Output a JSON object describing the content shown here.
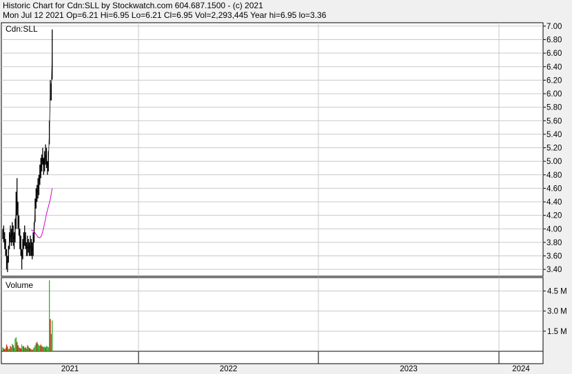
{
  "header": {
    "line1": "Historic Chart for Cdn:SLL by Stockwatch.com 604.687.1500 - (c) 2021",
    "line2": "Mon Jul 12 2021  Op=6.21  Hi=6.95  Lo=6.21  Cl=6.95  Vol=2,293,445  Year hi=6.95  lo=3.36"
  },
  "colors": {
    "background": "#ffffff",
    "grid": "#c8c8c8",
    "price_bar": "#000000",
    "moving_average": "#cc00cc",
    "volume_up": "#33aa33",
    "volume_down": "#cc2200"
  },
  "chart_data": [
    {
      "type": "line",
      "title": "Cdn:SLL",
      "ylim": [
        3.3,
        7.05
      ],
      "y_ticks": [
        "7.00",
        "6.80",
        "6.60",
        "6.40",
        "6.20",
        "6.00",
        "5.80",
        "5.60",
        "5.40",
        "5.20",
        "5.00",
        "4.80",
        "4.60",
        "4.40",
        "4.20",
        "4.00",
        "3.80",
        "3.60",
        "3.40"
      ],
      "x_labels": [
        "2021",
        "2022",
        "2023",
        "2024"
      ],
      "grid": true,
      "series": [
        {
          "style": "hl-bars",
          "high": [
            4.0,
            4.05,
            3.95,
            3.85,
            3.7,
            3.6,
            3.75,
            3.95,
            4.05,
            4.0,
            4.1,
            4.05,
            3.95,
            4.15,
            4.55,
            4.75,
            4.4,
            4.2,
            4.0,
            3.9,
            3.7,
            3.85,
            3.95,
            4.05,
            3.95,
            3.8,
            3.9,
            3.85,
            3.8,
            3.9,
            3.85,
            3.8,
            3.95,
            4.1,
            4.45,
            4.6,
            4.65,
            4.75,
            4.8,
            4.95,
            5.05,
            5.1,
            5.2,
            5.05,
            5.15,
            5.25,
            5.2,
            5.0,
            5.15,
            5.6,
            6.2,
            6.15,
            6.95
          ],
          "low": [
            3.85,
            3.8,
            3.7,
            3.6,
            3.4,
            3.36,
            3.5,
            3.7,
            3.8,
            3.75,
            3.8,
            3.75,
            3.7,
            3.8,
            4.0,
            4.2,
            4.0,
            3.9,
            3.7,
            3.6,
            3.4,
            3.55,
            3.7,
            3.75,
            3.7,
            3.6,
            3.6,
            3.65,
            3.6,
            3.6,
            3.6,
            3.55,
            3.6,
            3.8,
            4.1,
            4.3,
            4.4,
            4.45,
            4.5,
            4.65,
            4.75,
            4.85,
            4.95,
            4.8,
            4.85,
            4.95,
            4.9,
            4.8,
            4.85,
            5.25,
            5.9,
            5.9,
            6.21
          ]
        },
        {
          "style": "line",
          "start_index": 30,
          "values": [
            3.98,
            3.98,
            3.97,
            3.96,
            3.94,
            3.92,
            3.9,
            3.88,
            3.87,
            3.87,
            3.88,
            3.91,
            3.96,
            4.02,
            4.08,
            4.15,
            4.22,
            4.28,
            4.33,
            4.38,
            4.44,
            4.52,
            4.6
          ]
        }
      ]
    },
    {
      "type": "bar",
      "title": "Volume",
      "ylim": [
        0,
        5500000
      ],
      "y_ticks": [
        "4.5 M",
        "3.0 M",
        "1.5 M"
      ],
      "values": [
        300000,
        200000,
        150000,
        250000,
        500000,
        350000,
        150000,
        200000,
        400000,
        300000,
        550000,
        450000,
        250000,
        950000,
        1050000,
        700000,
        450000,
        300000,
        250000,
        200000,
        500000,
        350000,
        400000,
        250000,
        300000,
        200000,
        450000,
        350000,
        250000,
        200000,
        150000,
        100000,
        200000,
        300000,
        450000,
        600000,
        700000,
        550000,
        450000,
        400000,
        500000,
        400000,
        350000,
        300000,
        350000,
        300000,
        400000,
        350000,
        300000,
        450000,
        850000,
        700000,
        2293445
      ],
      "up": [
        1,
        0,
        0,
        1,
        0,
        0,
        1,
        1,
        0,
        1,
        1,
        0,
        1,
        1,
        1,
        0,
        0,
        1,
        0,
        0,
        1,
        1,
        0,
        1,
        0,
        1,
        0,
        1,
        0,
        0,
        1,
        0,
        1,
        1,
        1,
        1,
        0,
        1,
        1,
        1,
        0,
        1,
        0,
        1,
        1,
        0,
        1,
        1,
        1,
        1,
        0,
        1,
        1
      ],
      "annotations": [
        {
          "index": 49,
          "value": 5300000
        },
        {
          "index": 50,
          "value": 2400000
        },
        {
          "index": 51,
          "value": 1300000
        }
      ]
    }
  ]
}
